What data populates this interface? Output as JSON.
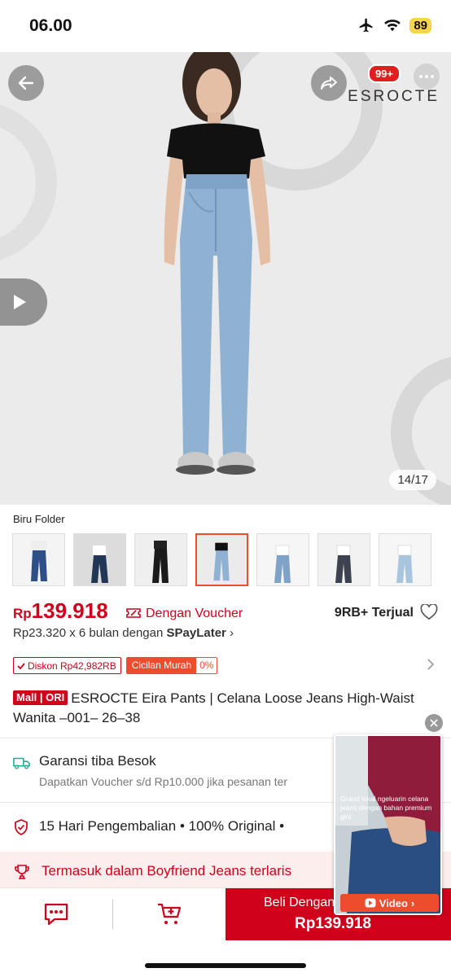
{
  "status_bar": {
    "time": "06.00",
    "battery": "89"
  },
  "hero": {
    "brand_logo": "ESROCTE",
    "cart_count": "99+",
    "image_counter": "14/17"
  },
  "variant": {
    "selected_label": "Biru Folder",
    "thumbnails": [
      "thumb-1",
      "thumb-2",
      "thumb-3",
      "thumb-4",
      "thumb-5",
      "thumb-6",
      "thumb-7"
    ],
    "selected_index": 3
  },
  "price": {
    "currency": "Rp",
    "amount": "139.918",
    "voucher_text": "Dengan Voucher",
    "sold": "9RB+ Terjual",
    "installment_prefix": "Rp23.320 x 6 bulan dengan",
    "installment_brand": "SPayLater"
  },
  "tags": {
    "discount": "Diskon Rp42,982RB",
    "cicilan": "Cicilan Murah",
    "cicilan_rate": "0%"
  },
  "product": {
    "badge_mall": "Mall",
    "badge_ori": "ORI",
    "title": "ESROCTE Eira Pants | Celana Loose Jeans High-Waist Wanita –001– 26–38"
  },
  "shipping": {
    "title": "Garansi tiba Besok",
    "subtitle": "Dapatkan Voucher s/d Rp10.000 jika pesanan ter"
  },
  "guarantee": {
    "text": "15 Hari Pengembalian  •  100% Original  •"
  },
  "bestseller": {
    "text": "Termasuk dalam Boyfriend Jeans terlaris"
  },
  "bottom_bar": {
    "buy_line1": "Beli Dengan",
    "buy_price": "Rp139.918"
  },
  "floating_video": {
    "caption": "Grand lokal ngeluarin celana jeans dengan bahan premium gini",
    "button_label": "Video"
  },
  "colors": {
    "brand_red": "#d0011b",
    "shopee_orange": "#ee4d2d"
  }
}
